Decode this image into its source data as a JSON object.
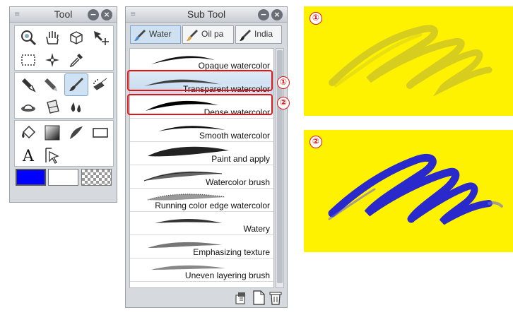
{
  "tool_palette": {
    "title": "Tool",
    "tools_row1": [
      "zoom-icon",
      "hand-icon",
      "3d-icon",
      "move-layer-icon"
    ],
    "tools_row2": [
      "rect-selection-icon",
      "auto-select-icon",
      "eyedropper-icon"
    ],
    "tools_row3": [
      "pen-icon",
      "pencil-icon",
      "brush-icon",
      "airbrush-icon"
    ],
    "tools_row4": [
      "decoration-icon",
      "eraser-icon",
      "blend-icon"
    ],
    "tools_row5": [
      "fill-icon",
      "gradient-icon",
      "figure-icon",
      "frame-icon"
    ],
    "tools_row6": [
      "text-icon",
      "operation-icon"
    ],
    "colors": {
      "main": "#0000ff",
      "sub": "#ffffff",
      "transparent": "checker"
    }
  },
  "sub_tool": {
    "title": "Sub Tool",
    "tabs": [
      {
        "label": "Water",
        "active": true
      },
      {
        "label": "Oil pa",
        "active": false
      },
      {
        "label": "India",
        "active": false
      }
    ],
    "brushes": [
      {
        "name": "Opaque watercolor",
        "selected": false
      },
      {
        "name": "Transparent watercolor",
        "selected": true
      },
      {
        "name": "Dense watercolor",
        "selected": false
      },
      {
        "name": "Smooth watercolor",
        "selected": false
      },
      {
        "name": "Paint and apply",
        "selected": false
      },
      {
        "name": "Watercolor brush",
        "selected": false
      },
      {
        "name": "Running color edge watercolor",
        "selected": false
      },
      {
        "name": "Watery",
        "selected": false
      },
      {
        "name": "Emphasizing texture",
        "selected": false
      },
      {
        "name": "Uneven layering brush",
        "selected": false
      }
    ],
    "bottom_icons": [
      "copy-subtool-icon",
      "new-subtool-icon",
      "delete-subtool-icon"
    ]
  },
  "callouts": {
    "one": "①",
    "two": "②"
  },
  "samples": {
    "one": {
      "badge": "①",
      "background": "#fff200",
      "stroke_color": "#c9c12a"
    },
    "two": {
      "badge": "②",
      "background": "#fff200",
      "stroke_color": "#2a2acc"
    }
  }
}
